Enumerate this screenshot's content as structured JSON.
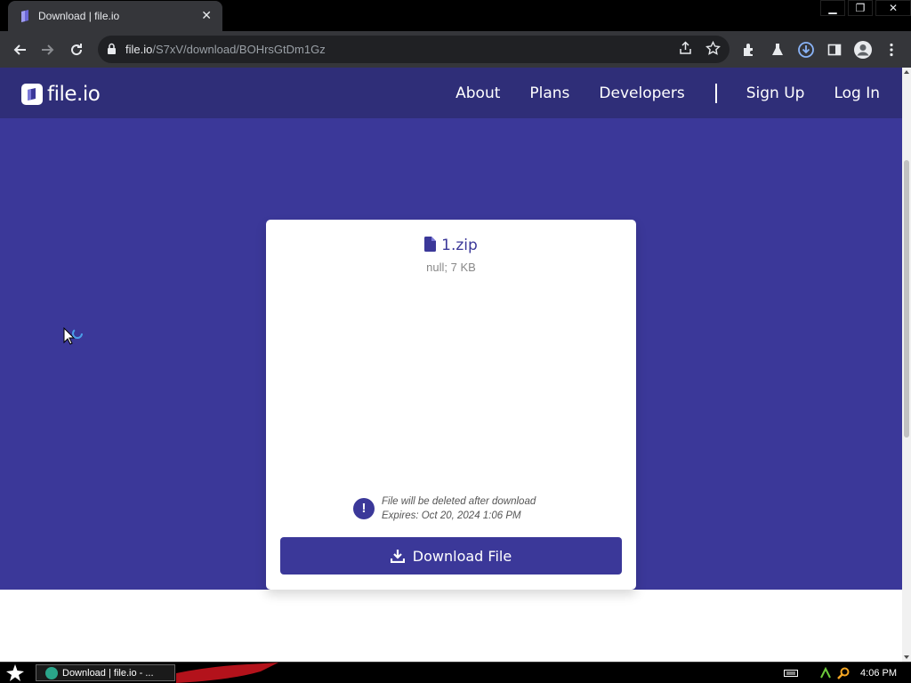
{
  "browser": {
    "tab_title": "Download | file.io",
    "url_host": "file.io",
    "url_path": "/S7xV/download/BOHrsGtDm1Gz"
  },
  "site": {
    "logo_text": "file.io",
    "nav": {
      "about": "About",
      "plans": "Plans",
      "developers": "Developers",
      "sign_up": "Sign Up",
      "log_in": "Log In"
    }
  },
  "card": {
    "file_name": "1.zip",
    "file_meta": "null; 7 KB",
    "notice_line1": "File will be deleted after download",
    "notice_line2": "Expires: Oct 20, 2024 1:06 PM",
    "download_label": "Download File"
  },
  "taskbar": {
    "task_label": "Download | file.io - ...",
    "clock": "4:06 PM"
  },
  "colors": {
    "brand_dark": "#2f2e78",
    "brand": "#3b3899"
  }
}
